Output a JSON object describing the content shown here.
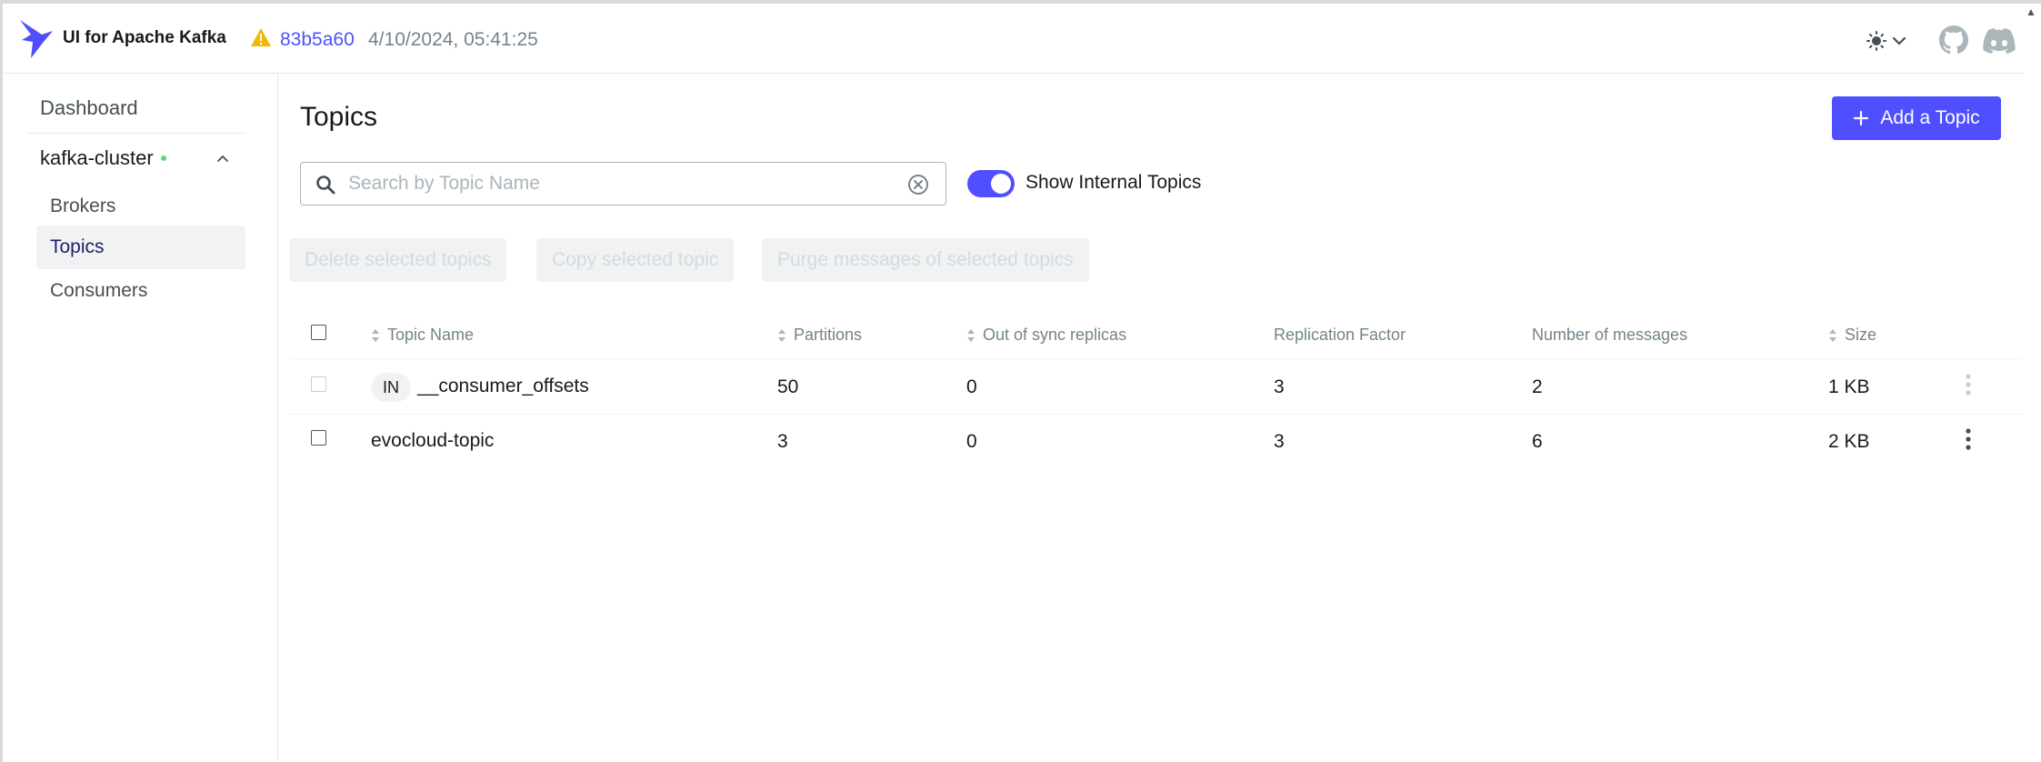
{
  "header": {
    "app_title": "UI for Apache Kafka",
    "commit": "83b5a60",
    "build_date": "4/10/2024, 05:41:25",
    "icons": [
      "kafka-logo-icon",
      "warning-icon",
      "sun-icon",
      "chevron-down-icon",
      "github-icon",
      "discord-icon"
    ]
  },
  "sidebar": {
    "dashboard": "Dashboard",
    "cluster": {
      "name": "kafka-cluster",
      "status_color": "#5cd685"
    },
    "items": [
      {
        "label": "Brokers",
        "active": false
      },
      {
        "label": "Topics",
        "active": true
      },
      {
        "label": "Consumers",
        "active": false
      }
    ]
  },
  "main": {
    "title": "Topics",
    "add_button": "Add a Topic",
    "search": {
      "placeholder": "Search by Topic Name",
      "value": ""
    },
    "show_internal": {
      "label": "Show Internal Topics",
      "enabled": true
    },
    "bulk_actions": [
      "Delete selected topics",
      "Copy selected topic",
      "Purge messages of selected topics"
    ],
    "table": {
      "columns": [
        "Topic Name",
        "Partitions",
        "Out of sync replicas",
        "Replication Factor",
        "Number of messages",
        "Size"
      ],
      "rows": [
        {
          "internal_badge": "IN",
          "name": "__consumer_offsets",
          "partitions": "50",
          "out_of_sync": "0",
          "replication": "3",
          "messages": "2",
          "size": "1 KB"
        },
        {
          "internal_badge": "",
          "name": "evocloud-topic",
          "partitions": "3",
          "out_of_sync": "0",
          "replication": "3",
          "messages": "6",
          "size": "2 KB"
        }
      ]
    }
  },
  "colors": {
    "accent": "#4f4fff",
    "warning": "#f5b700",
    "status_ok": "#5cd685"
  }
}
